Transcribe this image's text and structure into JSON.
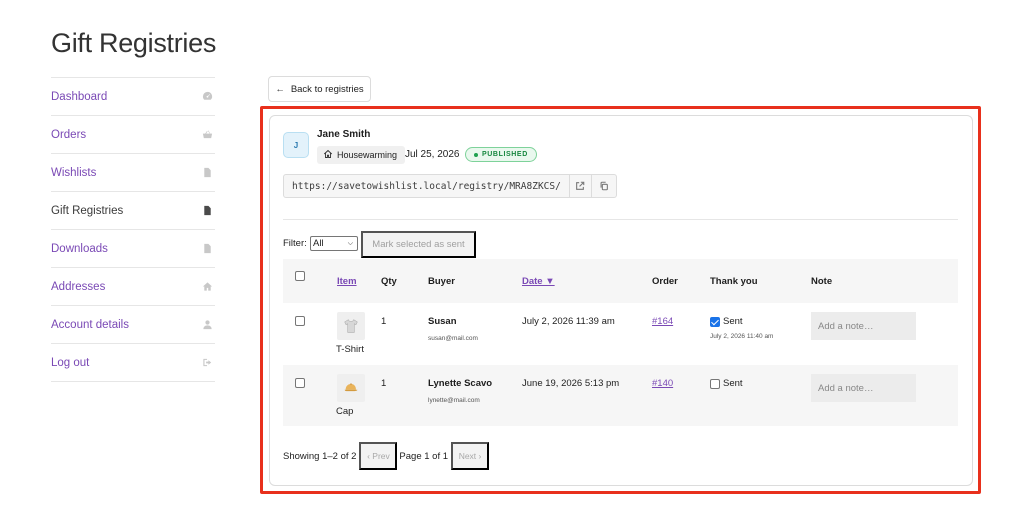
{
  "page": {
    "title": "Gift Registries"
  },
  "sidebar": {
    "items": [
      {
        "label": "Dashboard",
        "icon": "dashboard-icon"
      },
      {
        "label": "Orders",
        "icon": "basket-icon"
      },
      {
        "label": "Wishlists",
        "icon": "file-icon"
      },
      {
        "label": "Gift Registries",
        "icon": "file-icon",
        "active": true
      },
      {
        "label": "Downloads",
        "icon": "download-file-icon"
      },
      {
        "label": "Addresses",
        "icon": "home-icon"
      },
      {
        "label": "Account details",
        "icon": "user-icon"
      },
      {
        "label": "Log out",
        "icon": "sign-out-icon"
      }
    ]
  },
  "back_button": {
    "label": "Back to registries",
    "arrow": "←"
  },
  "registry": {
    "avatar_initial": "J",
    "owner_name": "Jane Smith",
    "occasion": "Housewarming",
    "event_date": "Jul 25, 2026",
    "status": "PUBLISHED",
    "url": "https://savetowishlist.local/registry/MRA8ZKCS/"
  },
  "filter": {
    "label": "Filter:",
    "selected": "All"
  },
  "mark_button": {
    "label": "Mark selected as sent"
  },
  "table": {
    "headers": {
      "item": "Item",
      "qty": "Qty",
      "buyer": "Buyer",
      "date": "Date ▼",
      "order": "Order",
      "thank_you": "Thank you",
      "note": "Note"
    },
    "rows": [
      {
        "product": "T-Shirt",
        "qty": "1",
        "buyer_name": "Susan",
        "buyer_email": "susan@mail.com",
        "date": "July 2, 2026 11:39 am",
        "order": "#164",
        "sent_label": "Sent",
        "sent_checked": true,
        "sent_date": "July 2, 2026 11:40 am",
        "note_placeholder": "Add a note…"
      },
      {
        "product": "Cap",
        "qty": "1",
        "buyer_name": "Lynette Scavo",
        "buyer_email": "lynette@mail.com",
        "date": "June 19, 2026 5:13 pm",
        "order": "#140",
        "sent_label": "Sent",
        "sent_checked": false,
        "sent_date": "",
        "note_placeholder": "Add a note…"
      }
    ]
  },
  "pagination": {
    "showing": "Showing 1–2 of 2",
    "prev": "‹ Prev",
    "page_info": "Page 1 of 1",
    "next": "Next ›"
  },
  "colors": {
    "accent": "#7a49b5",
    "highlight": "#e8301c",
    "published": "#16873f"
  }
}
